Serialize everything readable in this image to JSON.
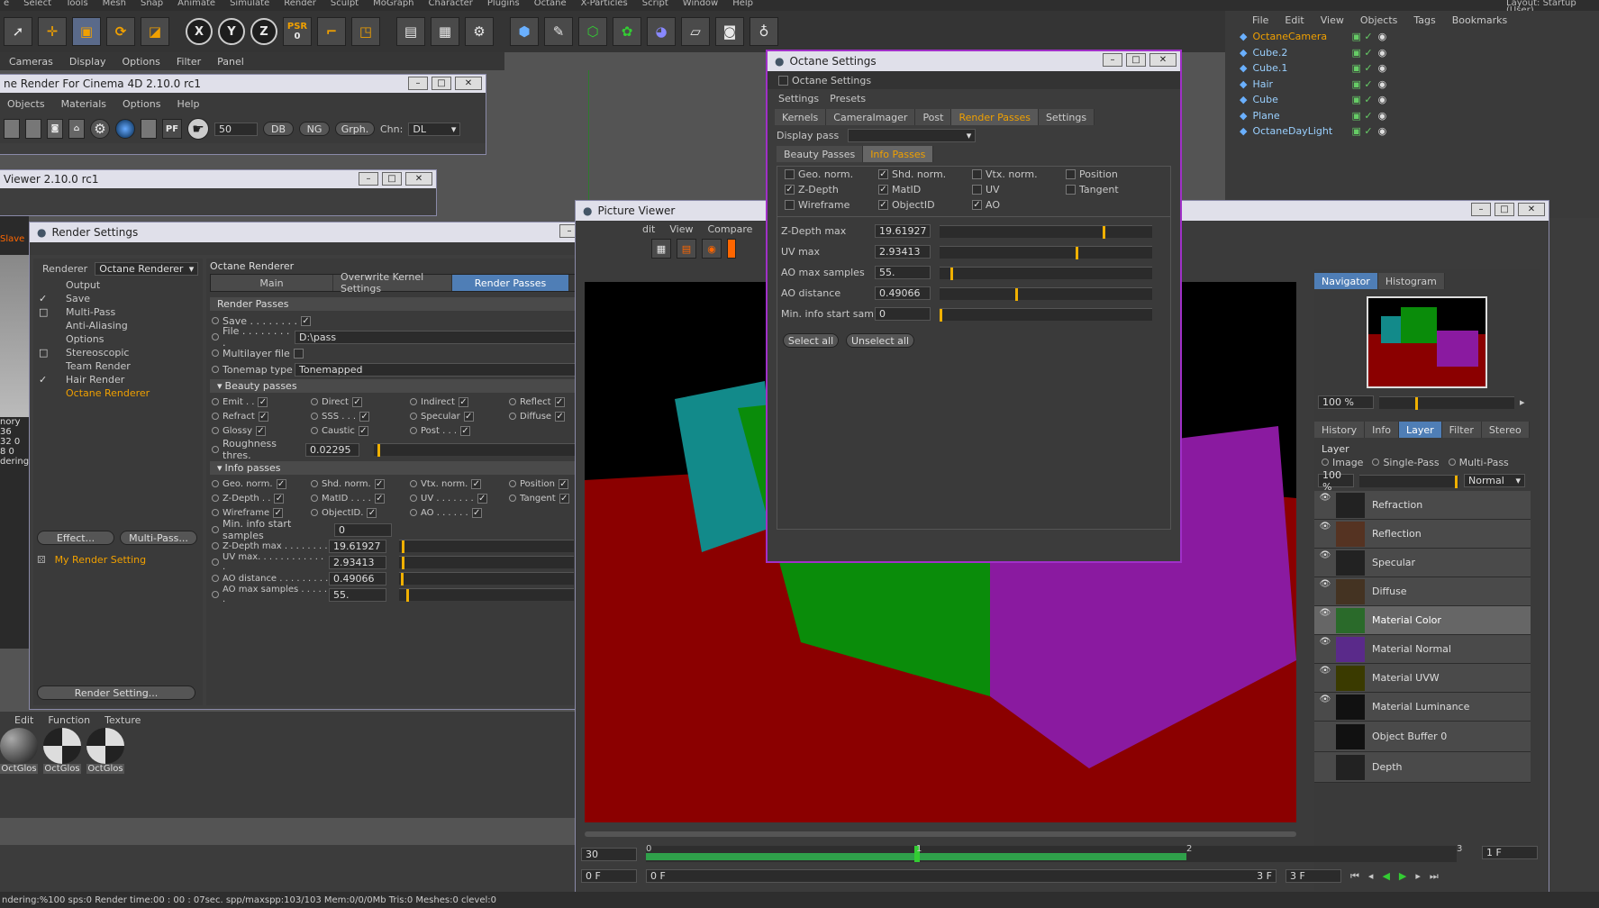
{
  "menu": [
    "e",
    "Select",
    "Tools",
    "Mesh",
    "Snap",
    "Animate",
    "Simulate",
    "Render",
    "Sculpt",
    "MoGraph",
    "Character",
    "Plugins",
    "Octane",
    "X-Particles",
    "Script",
    "Window",
    "Help"
  ],
  "layout_label": "Layout:",
  "layout_value": "Startup (User)",
  "toolbar": {
    "psr_label": "PSR",
    "psr_value": "0",
    "x": "X",
    "y": "Y",
    "z": "Z"
  },
  "viewport_menu": [
    "Cameras",
    "Display",
    "Options",
    "Filter",
    "Panel"
  ],
  "octane_render_window": {
    "title": "ne Render For Cinema 4D 2.10.0 rc1",
    "menu": [
      "Objects",
      "Materials",
      "Options",
      "Help"
    ],
    "value": "50",
    "buttons": [
      "DB",
      "NG",
      "Grph."
    ],
    "chn_label": "Chn:",
    "chn_value": "DL",
    "pf_label": "PF"
  },
  "viewer_window": {
    "title": "Viewer 2.10.0 rc1"
  },
  "side_stats": {
    "lines": [
      "nory",
      "36",
      "32 0",
      "8 0",
      "dering"
    ],
    "red": "Slave"
  },
  "render_settings": {
    "title": "Render Settings",
    "renderer_label": "Renderer",
    "renderer_value": "Octane Renderer",
    "tree": [
      {
        "label": "Output",
        "check": ""
      },
      {
        "label": "Save",
        "check": "✓"
      },
      {
        "label": "Multi-Pass",
        "check": "□"
      },
      {
        "label": "Anti-Aliasing",
        "check": ""
      },
      {
        "label": "Options",
        "check": ""
      },
      {
        "label": "Stereoscopic",
        "check": "□"
      },
      {
        "label": "Team Render",
        "check": ""
      },
      {
        "label": "Hair Render",
        "check": "✓"
      },
      {
        "label": "Octane Renderer",
        "check": "",
        "active": true
      }
    ],
    "effect_btn": "Effect...",
    "multipass_btn": "Multi-Pass...",
    "my_setting": "My Render Setting",
    "render_setting_btn": "Render Setting...",
    "panel_title": "Octane Renderer",
    "tabs": [
      "Main",
      "Overwrite Kernel Settings",
      "Render Passes"
    ],
    "section_title": "Render Passes",
    "save_label": "Save . . . . . . . .",
    "file_label": "File . . . . . . . . .",
    "file_value": "D:\\pass",
    "file_btn": "...",
    "multilayer_label": "Multilayer file",
    "tonemap_label": "Tonemap type",
    "tonemap_value": "Tonemapped",
    "beauty_title": "Beauty passes",
    "beauty": [
      [
        "Emit . .",
        "Direct",
        "Indirect",
        "Reflect"
      ],
      [
        "Refract",
        "SSS . . .",
        "Specular",
        "Diffuse"
      ],
      [
        "Glossy",
        "Caustic",
        "Post . . .",
        ""
      ]
    ],
    "roughness_label": "Roughness thres.",
    "roughness_value": "0.02295",
    "info_title": "Info passes",
    "info": [
      [
        "Geo. norm.",
        "Shd. norm.",
        "Vtx. norm.",
        "Position"
      ],
      [
        "Z-Depth . .",
        "MatID . . . .",
        "UV . . . . . . .",
        "Tangent"
      ],
      [
        "Wireframe",
        "ObjectID.",
        "AO . . . . . .",
        ""
      ]
    ],
    "minsamples_label": "Min. info start samples",
    "minsamples_value": "0",
    "zdepth_label": "Z-Depth max . . . . . . . .",
    "zdepth_value": "19.61927",
    "uv_label": "UV max. . . . . . . . . . . . .",
    "uv_value": "2.93413",
    "aodist_label": "AO distance . . . . . . . . .",
    "aodist_value": "0.49066",
    "aomax_label": "AO max samples . . . . . .",
    "aomax_value": "55."
  },
  "octane_settings": {
    "title": "Octane Settings",
    "subtitle": "Octane Settings",
    "menu": [
      "Settings",
      "Presets"
    ],
    "tabs": [
      "Kernels",
      "CameraImager",
      "Post",
      "Render Passes",
      "Settings"
    ],
    "display_pass_label": "Display pass",
    "subtabs": [
      "Beauty Passes",
      "Info Passes"
    ],
    "checks": [
      [
        {
          "l": "Geo. norm.",
          "c": ""
        },
        {
          "l": "Shd. norm.",
          "c": "✓"
        },
        {
          "l": "Vtx. norm.",
          "c": ""
        },
        {
          "l": "Position",
          "c": ""
        }
      ],
      [
        {
          "l": "Z-Depth",
          "c": "✓"
        },
        {
          "l": "MatID",
          "c": "✓"
        },
        {
          "l": "UV",
          "c": ""
        },
        {
          "l": "Tangent",
          "c": ""
        }
      ],
      [
        {
          "l": "Wireframe",
          "c": ""
        },
        {
          "l": "ObjectID",
          "c": "✓"
        },
        {
          "l": "AO",
          "c": "✓"
        },
        {
          "l": "",
          "c": ""
        }
      ]
    ],
    "params": [
      {
        "label": "Z-Depth max",
        "value": "19.61927",
        "level": 0.78
      },
      {
        "label": "UV max",
        "value": "2.93413",
        "level": 0.65
      },
      {
        "label": "AO max samples",
        "value": "55.",
        "level": 0.05
      },
      {
        "label": "AO distance",
        "value": "0.49066",
        "level": 0.36
      },
      {
        "label": "Min. info start sam",
        "value": "0",
        "level": 0.0
      }
    ],
    "select_all": "Select all",
    "unselect_all": "Unselect all"
  },
  "picture_viewer": {
    "title": "Picture Viewer",
    "menu": [
      "dit",
      "View",
      "Compare",
      "A"
    ],
    "nav_tabs": [
      "Navigator",
      "Histogram"
    ],
    "zoom": "100 %",
    "lower_tabs": [
      "History",
      "Info",
      "Layer",
      "Filter",
      "Stereo"
    ],
    "layer_title": "Layer",
    "layer_modes": [
      "Image",
      "Single-Pass",
      "Multi-Pass"
    ],
    "opacity": "100 %",
    "blend": "Normal",
    "layers": [
      "Refraction",
      "Reflection",
      "Specular",
      "Diffuse",
      "Material Color",
      "Material Normal",
      "Material UVW",
      "Material Luminance",
      "Object Buffer 0",
      "Depth"
    ],
    "active_layer": "Material Color",
    "timeline": {
      "frame_field": "30",
      "marks": [
        "0",
        "1",
        "2",
        "3"
      ],
      "start": "0 F",
      "end_field": "3 F",
      "right_field": "1 F",
      "inner_start": "0 F",
      "inner_end": "3 F"
    }
  },
  "object_manager": {
    "menu": [
      "File",
      "Edit",
      "View",
      "Objects",
      "Tags",
      "Bookmarks"
    ],
    "objects": [
      "OctaneCamera",
      "Cube.2",
      "Cube.1",
      "Hair",
      "Cube",
      "Plane",
      "OctaneDayLight"
    ]
  },
  "material_bar": {
    "menu": [
      "Edit",
      "Function",
      "Texture"
    ],
    "materials": [
      "OctGlos",
      "OctGlos",
      "OctGlos"
    ]
  },
  "status_bar": "ndering:%100 sps:0 Render time:00 : 00 : 07sec. spp/maxspp:103/103 Mem:0/0/0Mb Tris:0 Meshes:0 clevel:0",
  "colors": {
    "accent": "#f0a000",
    "selected_tab": "#4f7eb6",
    "red": "#8b0000",
    "green": "#0a8c0a",
    "purple": "#8a1aa0",
    "teal": "#128a8a"
  }
}
